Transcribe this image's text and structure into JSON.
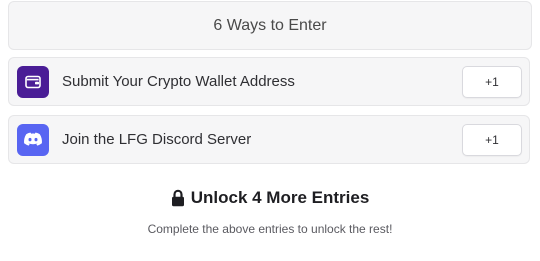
{
  "header": {
    "title": "6 Ways to Enter"
  },
  "entries": [
    {
      "icon": "wallet-icon",
      "icon_bg": "#4a1d96",
      "label": "Submit Your Crypto Wallet Address",
      "points": "+1"
    },
    {
      "icon": "discord-icon",
      "icon_bg": "#5865f2",
      "label": "Join the LFG Discord Server",
      "points": "+1"
    }
  ],
  "unlock": {
    "icon": "lock-icon",
    "title": "Unlock 4 More Entries",
    "subtitle": "Complete the above entries to unlock the rest!"
  }
}
